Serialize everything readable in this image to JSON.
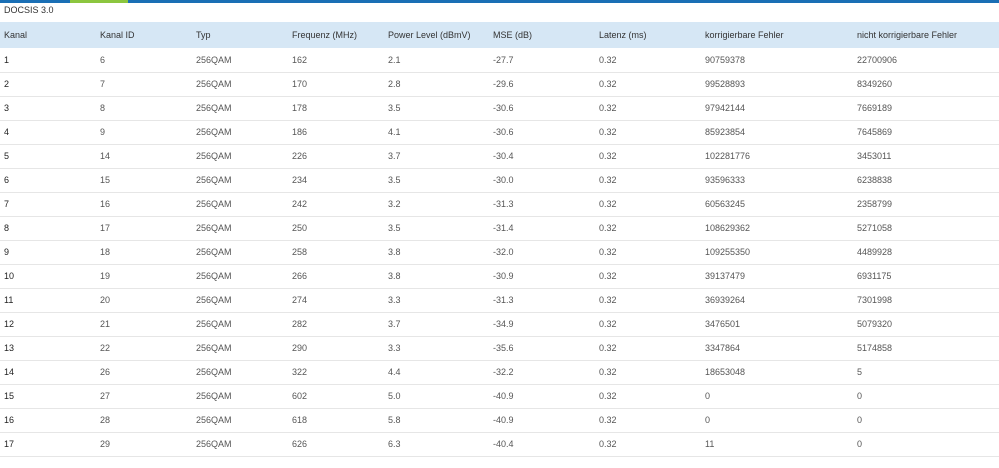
{
  "section_title": "DOCSIS 3.0",
  "colors": {
    "top_bar": "#1a6fb5",
    "tab_accent": "#8cc63f",
    "header_bg": "#d6e7f5"
  },
  "table": {
    "headers": [
      "Kanal",
      "Kanal ID",
      "Typ",
      "Frequenz (MHz)",
      "Power Level (dBmV)",
      "MSE (dB)",
      "Latenz (ms)",
      "korrigierbare Fehler",
      "nicht korrigierbare Fehler"
    ],
    "rows": [
      [
        "1",
        "6",
        "256QAM",
        "162",
        "2.1",
        "-27.7",
        "0.32",
        "90759378",
        "22700906"
      ],
      [
        "2",
        "7",
        "256QAM",
        "170",
        "2.8",
        "-29.6",
        "0.32",
        "99528893",
        "8349260"
      ],
      [
        "3",
        "8",
        "256QAM",
        "178",
        "3.5",
        "-30.6",
        "0.32",
        "97942144",
        "7669189"
      ],
      [
        "4",
        "9",
        "256QAM",
        "186",
        "4.1",
        "-30.6",
        "0.32",
        "85923854",
        "7645869"
      ],
      [
        "5",
        "14",
        "256QAM",
        "226",
        "3.7",
        "-30.4",
        "0.32",
        "102281776",
        "3453011"
      ],
      [
        "6",
        "15",
        "256QAM",
        "234",
        "3.5",
        "-30.0",
        "0.32",
        "93596333",
        "6238838"
      ],
      [
        "7",
        "16",
        "256QAM",
        "242",
        "3.2",
        "-31.3",
        "0.32",
        "60563245",
        "2358799"
      ],
      [
        "8",
        "17",
        "256QAM",
        "250",
        "3.5",
        "-31.4",
        "0.32",
        "108629362",
        "5271058"
      ],
      [
        "9",
        "18",
        "256QAM",
        "258",
        "3.8",
        "-32.0",
        "0.32",
        "109255350",
        "4489928"
      ],
      [
        "10",
        "19",
        "256QAM",
        "266",
        "3.8",
        "-30.9",
        "0.32",
        "39137479",
        "6931175"
      ],
      [
        "11",
        "20",
        "256QAM",
        "274",
        "3.3",
        "-31.3",
        "0.32",
        "36939264",
        "7301998"
      ],
      [
        "12",
        "21",
        "256QAM",
        "282",
        "3.7",
        "-34.9",
        "0.32",
        "3476501",
        "5079320"
      ],
      [
        "13",
        "22",
        "256QAM",
        "290",
        "3.3",
        "-35.6",
        "0.32",
        "3347864",
        "5174858"
      ],
      [
        "14",
        "26",
        "256QAM",
        "322",
        "4.4",
        "-32.2",
        "0.32",
        "18653048",
        "5"
      ],
      [
        "15",
        "27",
        "256QAM",
        "602",
        "5.0",
        "-40.9",
        "0.32",
        "0",
        "0"
      ],
      [
        "16",
        "28",
        "256QAM",
        "618",
        "5.8",
        "-40.9",
        "0.32",
        "0",
        "0"
      ],
      [
        "17",
        "29",
        "256QAM",
        "626",
        "6.3",
        "-40.4",
        "0.32",
        "11",
        "0"
      ]
    ]
  }
}
